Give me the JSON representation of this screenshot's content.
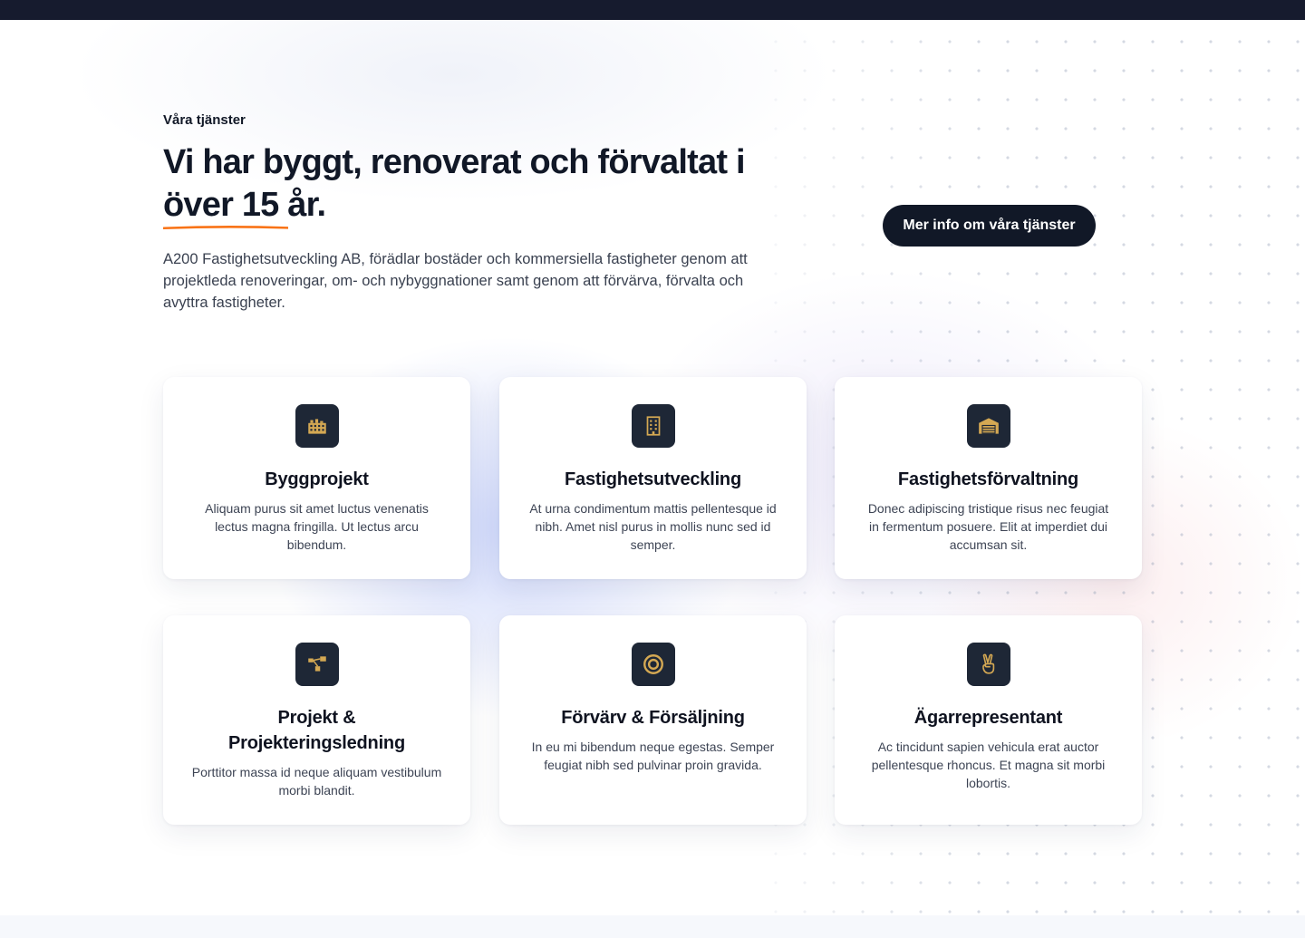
{
  "section": {
    "eyebrow": "Våra tjänster",
    "headline_main": "Vi har byggt, renoverat och förvaltat i",
    "headline_highlight": "över 15 år.",
    "lead": "A200 Fastighetsutveckling AB, förädlar bostäder och kommersiella fastigheter genom att projektleda renoveringar, om- och nybyggnationer samt genom att förvärva, förvalta och avyttra fastigheter.",
    "cta_label": "Mer info om våra tjänster"
  },
  "colors": {
    "accent": "#f97316",
    "dark": "#111827",
    "icon_bg": "#1e2736",
    "icon_fg": "#d4a853"
  },
  "services": [
    {
      "icon": "buildings-icon",
      "title": "Byggprojekt",
      "text": "Aliquam purus sit amet luctus venenatis lectus magna fringilla. Ut lectus arcu bibendum."
    },
    {
      "icon": "office-building-icon",
      "title": "Fastighetsutveckling",
      "text": "At urna condimentum mattis pellentesque id nibh. Amet nisl purus in mollis nunc sed id semper."
    },
    {
      "icon": "warehouse-icon",
      "title": "Fastighetsförvaltning",
      "text": "Donec adipiscing tristique risus nec feugiat in fermentum posuere. Elit at imperdiet dui accumsan sit."
    },
    {
      "icon": "diagram-icon",
      "title": "Projekt & Projekteringsledning",
      "text": "Porttitor massa id neque aliquam vestibulum morbi blandit."
    },
    {
      "icon": "target-icon",
      "title": "Förvärv & Försäljning",
      "text": "In eu mi bibendum neque egestas. Semper feugiat nibh sed pulvinar proin gravida."
    },
    {
      "icon": "victory-hand-icon",
      "title": "Ägarrepresentant",
      "text": "Ac tincidunt sapien vehicula erat auctor pellentesque rhoncus. Et magna sit morbi lobortis."
    }
  ]
}
